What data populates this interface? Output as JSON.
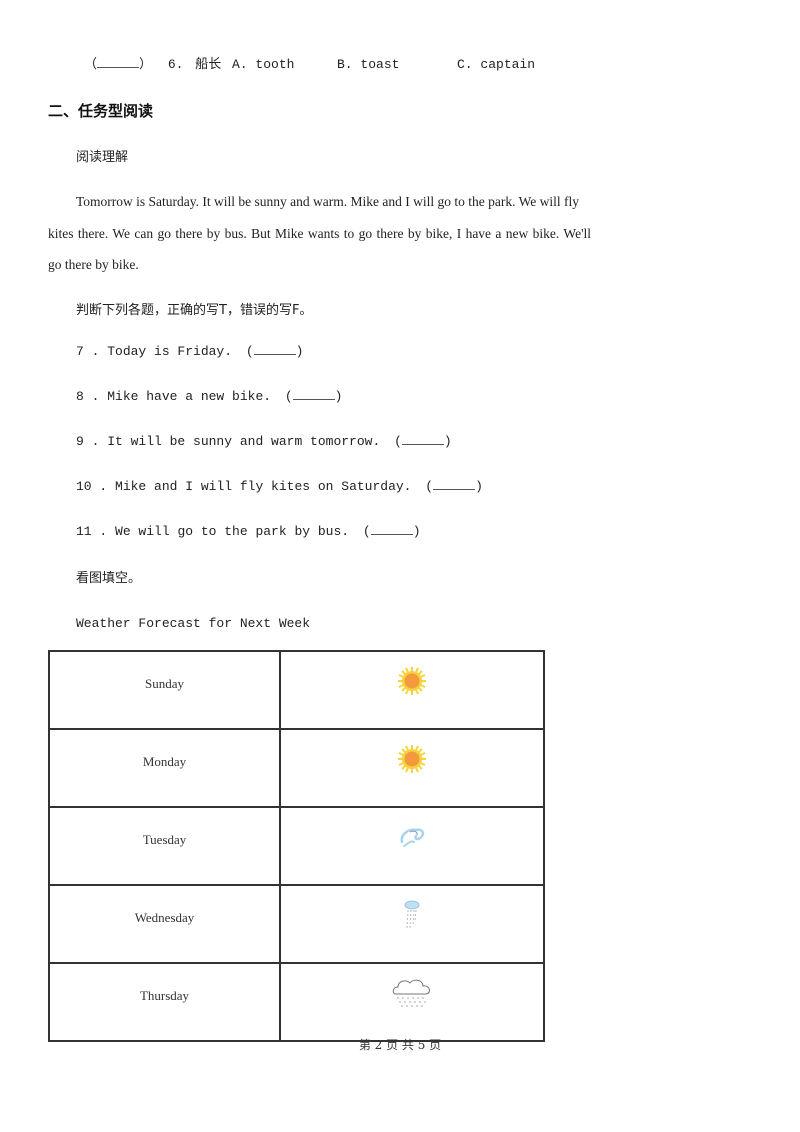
{
  "question6": {
    "bracket_open": "（",
    "bracket_close": "）",
    "number": "6.",
    "word": "船长",
    "options": [
      {
        "letter": "A.",
        "text": "tooth"
      },
      {
        "letter": "B.",
        "text": "toast"
      },
      {
        "letter": "C.",
        "text": "captain"
      }
    ]
  },
  "section2": {
    "heading": "二、任务型阅读",
    "subheading": "阅读理解",
    "passage_lines": [
      "Tomorrow is Saturday. It will be sunny and warm. Mike and I will go to the park. We will fly",
      "kites there. We can go there by bus. But Mike wants to go there by bike, I have a new bike. We'll",
      "go there by bike."
    ],
    "instruction": "判断下列各题，正确的写T，错误的写F。",
    "questions": [
      {
        "number": "7 .",
        "text": "Today is Friday."
      },
      {
        "number": "8 .",
        "text": "Mike have a new bike."
      },
      {
        "number": "9 .",
        "text": "It will be sunny and warm tomorrow."
      },
      {
        "number": "10 .",
        "text": "Mike and I will fly kites on Saturday."
      },
      {
        "number": "11 .",
        "text": "We will go to the park by bus."
      }
    ],
    "fill_instruction": "看图填空。",
    "table_title": "Weather Forecast for Next Week",
    "forecast": [
      {
        "day": "Sunday",
        "icon": "sunny-icon"
      },
      {
        "day": "Monday",
        "icon": "sunny-icon"
      },
      {
        "day": "Tuesday",
        "icon": "windy-icon"
      },
      {
        "day": "Wednesday",
        "icon": "shower-icon"
      },
      {
        "day": "Thursday",
        "icon": "rainy-cloud-icon"
      }
    ]
  },
  "footer": {
    "page_label": "第 2 页 共 5 页"
  },
  "colors": {
    "sun_core": "#f39a3e",
    "sun_rays": "#f7d23a",
    "wind_blue": "#a9d3ee",
    "cloud_gray": "#777777"
  }
}
